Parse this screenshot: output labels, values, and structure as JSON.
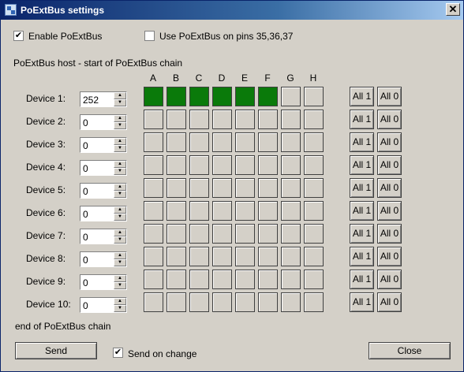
{
  "window": {
    "title": "PoExtBus settings",
    "close_glyph": "✕"
  },
  "options": {
    "enable_label": "Enable PoExtBus",
    "enable_checked": true,
    "pins_label": "Use PoExtBus on pins 35,36,37",
    "pins_checked": false
  },
  "chain_start_label": "PoExtBus host - start of PoExtBus chain",
  "chain_end_label": "end of PoExtBus chain",
  "columns": [
    "A",
    "B",
    "C",
    "D",
    "E",
    "F",
    "G",
    "H"
  ],
  "devices": [
    {
      "label": "Device 1:",
      "value": "252",
      "bits": [
        1,
        1,
        1,
        1,
        1,
        1,
        0,
        0
      ]
    },
    {
      "label": "Device 2:",
      "value": "0",
      "bits": [
        0,
        0,
        0,
        0,
        0,
        0,
        0,
        0
      ]
    },
    {
      "label": "Device 3:",
      "value": "0",
      "bits": [
        0,
        0,
        0,
        0,
        0,
        0,
        0,
        0
      ]
    },
    {
      "label": "Device 4:",
      "value": "0",
      "bits": [
        0,
        0,
        0,
        0,
        0,
        0,
        0,
        0
      ]
    },
    {
      "label": "Device 5:",
      "value": "0",
      "bits": [
        0,
        0,
        0,
        0,
        0,
        0,
        0,
        0
      ]
    },
    {
      "label": "Device 6:",
      "value": "0",
      "bits": [
        0,
        0,
        0,
        0,
        0,
        0,
        0,
        0
      ]
    },
    {
      "label": "Device 7:",
      "value": "0",
      "bits": [
        0,
        0,
        0,
        0,
        0,
        0,
        0,
        0
      ]
    },
    {
      "label": "Device 8:",
      "value": "0",
      "bits": [
        0,
        0,
        0,
        0,
        0,
        0,
        0,
        0
      ]
    },
    {
      "label": "Device 9:",
      "value": "0",
      "bits": [
        0,
        0,
        0,
        0,
        0,
        0,
        0,
        0
      ]
    },
    {
      "label": "Device 10:",
      "value": "0",
      "bits": [
        0,
        0,
        0,
        0,
        0,
        0,
        0,
        0
      ]
    }
  ],
  "all1_label": "All 1",
  "all0_label": "All 0",
  "footer": {
    "send_label": "Send",
    "send_on_change_label": "Send on change",
    "send_on_change_checked": true,
    "close_label": "Close"
  },
  "colors": {
    "bit_on": "#0a7a0a",
    "bit_off": "#d4d0c8"
  },
  "icons": {
    "window": "app-icon",
    "checkmark": "✔",
    "spin_up": "▲",
    "spin_down": "▼"
  }
}
